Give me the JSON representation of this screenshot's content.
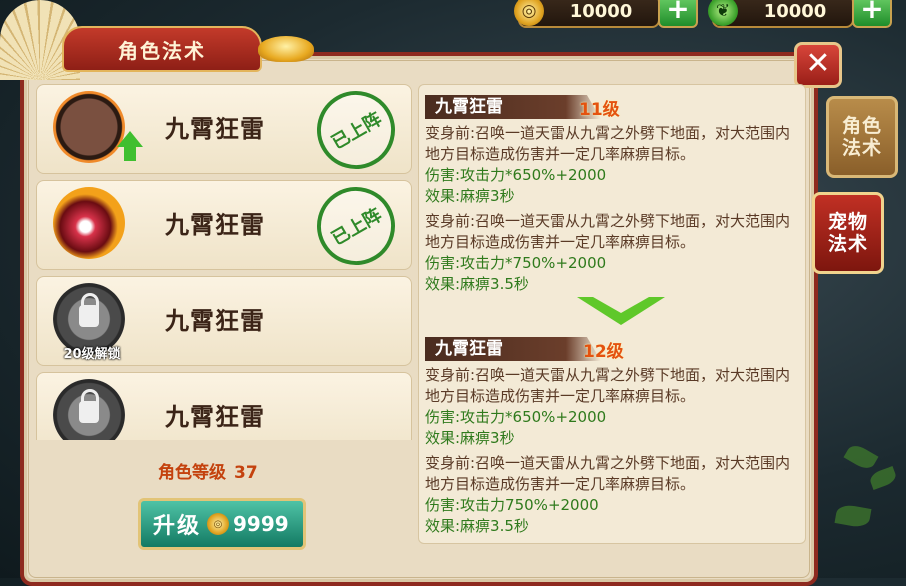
{
  "currency": [
    {
      "icon": "gold-coin-icon",
      "value": "10000"
    },
    {
      "icon": "green-jade-icon",
      "value": "10000"
    }
  ],
  "panel": {
    "title": "角色法术"
  },
  "skills": [
    {
      "name": "九霄狂雷",
      "status": "已上阵",
      "locked": false
    },
    {
      "name": "九霄狂雷",
      "status": "已上阵",
      "locked": false
    },
    {
      "name": "九霄狂雷",
      "lock_text": "20级解锁",
      "locked": true
    },
    {
      "name": "九霄狂雷",
      "locked": true
    }
  ],
  "level": {
    "label": "角色等级",
    "value": "37"
  },
  "upgrade": {
    "label": "升级",
    "cost": "9999"
  },
  "details": [
    {
      "name": "九霄狂雷",
      "level": "11级",
      "entries": [
        {
          "desc": "变身前:召唤一道天雷从九霄之外劈下地面，对大范围内地方目标造成伤害并一定几率麻痹目标。",
          "damage": "伤害:攻击力*650%+2000",
          "effect": "效果:麻痹3秒"
        },
        {
          "desc": "变身前:召唤一道天雷从九霄之外劈下地面，对大范围内地方目标造成伤害并一定几率麻痹目标。",
          "damage": "伤害:攻击力*750%+2000",
          "effect": "效果:麻痹3.5秒"
        }
      ]
    },
    {
      "name": "九霄狂雷",
      "level": "12级",
      "entries": [
        {
          "desc": "变身前:召唤一道天雷从九霄之外劈下地面，对大范围内地方目标造成伤害并一定几率麻痹目标。",
          "damage": "伤害:攻击力*650%+2000",
          "effect": "效果:麻痹3秒"
        },
        {
          "desc": "变身前:召唤一道天雷从九霄之外劈下地面，对大范围内地方目标造成伤害并一定几率麻痹目标。",
          "damage": "伤害:攻击力750%+2000",
          "effect": "效果:麻痹3.5秒"
        }
      ]
    }
  ],
  "tabs": [
    {
      "label": "角色法术",
      "active": false
    },
    {
      "label": "宠物法术",
      "active": true
    }
  ],
  "colors": {
    "panel_border": "#8e2a1f",
    "accent_orange": "#e4520f",
    "stat_green": "#2f7a1c",
    "panel_bg": "#e9dcc3"
  }
}
